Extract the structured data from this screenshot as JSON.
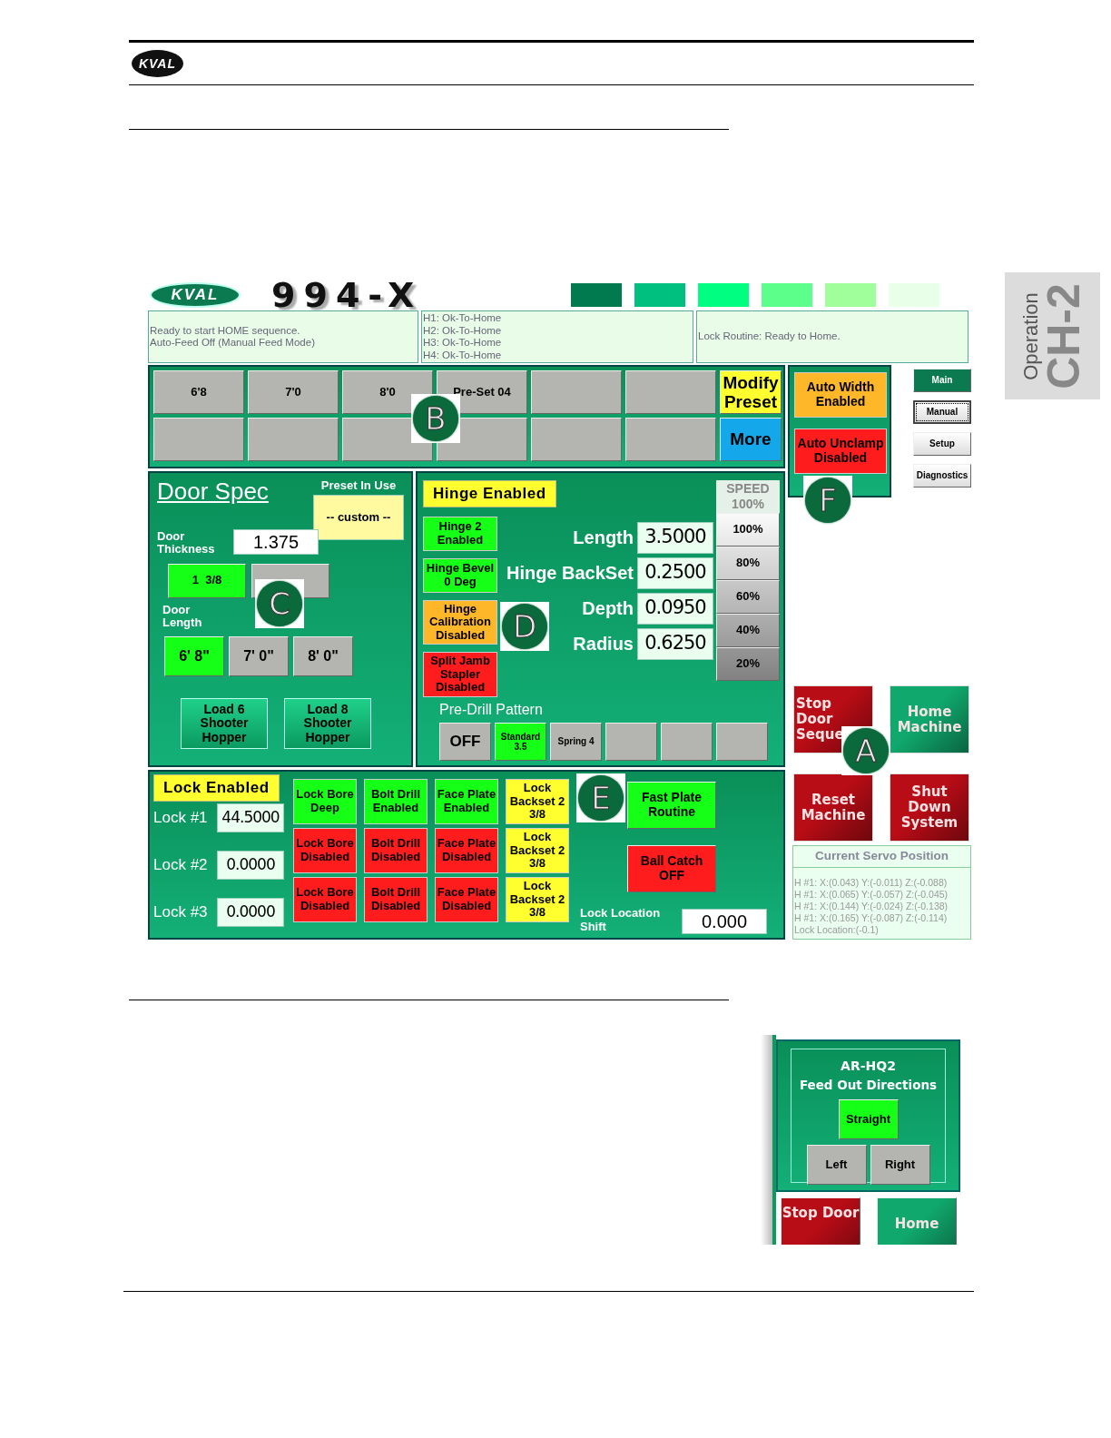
{
  "document": {
    "brand": "KVAL",
    "side_tab": {
      "section": "Operation",
      "chapter": "CH-2"
    }
  },
  "hmi": {
    "brand": "KVAL",
    "model": "994-X",
    "swatches": [
      {
        "color": "#007a4e"
      },
      {
        "color": "#00c080"
      },
      {
        "color": "#00ff80"
      },
      {
        "color": "#5cff8a"
      },
      {
        "color": "#a0ff9a"
      },
      {
        "color": "#e8ffe8"
      }
    ],
    "status_panes": [
      {
        "lines": [
          "Ready to start HOME sequence.",
          "Auto-Feed Off (Manual Feed Mode)"
        ]
      },
      {
        "lines": [
          "H1: Ok-To-Home",
          "H2: Ok-To-Home",
          "H3: Ok-To-Home",
          "H4: Ok-To-Home"
        ]
      },
      {
        "lines": [
          "Lock Routine: Ready to Home."
        ]
      }
    ],
    "presets": {
      "callout": "B",
      "items": [
        {
          "label": "6'8"
        },
        {
          "label": "7'0"
        },
        {
          "label": "8'0"
        },
        {
          "label": "Pre-Set 04"
        }
      ],
      "actions": [
        {
          "label": "Modify Preset",
          "color": "#ffff30"
        },
        {
          "label": "More",
          "color": "#14a8ea"
        }
      ]
    },
    "auto_settings": {
      "callout": "F",
      "items": [
        {
          "label": "Auto Width Enabled",
          "color": "#ffb72a"
        },
        {
          "label": "Auto Unclamp Disabled",
          "color": "#ff1c1c"
        }
      ]
    },
    "nav": [
      {
        "label": "Main",
        "selected": true,
        "focused": false
      },
      {
        "label": "Manual",
        "selected": false,
        "focused": true
      },
      {
        "label": "Setup",
        "selected": false,
        "focused": false
      },
      {
        "label": "Diagnostics",
        "selected": false,
        "focused": false
      }
    ],
    "door_spec": {
      "callout": "C",
      "title": "Door Spec",
      "preset_label": "Preset In Use",
      "preset": "-- custom --",
      "thickness_label": "Door Thickness",
      "thickness": "1.375",
      "thickness_options": [
        {
          "label": "1  3/8",
          "selected": true
        },
        {
          "selected": false
        }
      ],
      "length_label": "Door Length",
      "length_options": [
        {
          "label": "6' 8\"",
          "selected": true
        },
        {
          "label": "7' 0\"",
          "selected": false
        },
        {
          "label": "8' 0\"",
          "selected": false
        }
      ],
      "load_buttons": [
        "Load 6 Shooter Hopper",
        "Load 8 Shooter Hopper"
      ]
    },
    "hinge": {
      "callout": "D",
      "title": "Hinge Enabled",
      "toggles": [
        {
          "label": "Hinge 2 Enabled",
          "color": "#16ff16"
        },
        {
          "label": "Hinge Bevel 0 Deg",
          "color": "#16ff16"
        },
        {
          "label": "Hinge Calibration Disabled",
          "color": "#ffb72a"
        },
        {
          "label": "Split Jamb Stapler Disabled",
          "color": "#ff1c1c"
        }
      ],
      "params": [
        {
          "label": "Length",
          "value": "3.5000"
        },
        {
          "label": "Hinge BackSet",
          "value": "0.2500"
        },
        {
          "label": "Depth",
          "value": "0.0950"
        },
        {
          "label": "Radius",
          "value": "0.6250"
        }
      ],
      "speed": {
        "title": "SPEED",
        "current": "100%",
        "options": [
          "100%",
          "80%",
          "60%",
          "40%",
          "20%"
        ]
      },
      "pre_drill": {
        "label": "Pre-Drill Pattern",
        "options": [
          {
            "label": "OFF",
            "selected": false
          },
          {
            "label": "Standard 3.5",
            "selected": true
          },
          {
            "label": "Spring 4",
            "selected": false
          }
        ]
      }
    },
    "lock": {
      "callout": "E",
      "title": "Lock Enabled",
      "rows": [
        {
          "label": "Lock #1",
          "value": "44.5000",
          "toggles": [
            {
              "label": "Lock Bore Deep",
              "color": "#16ff16"
            },
            {
              "label": "Bolt Drill Enabled",
              "color": "#16ff16"
            },
            {
              "label": "Face Plate Enabled",
              "color": "#16ff16"
            },
            {
              "label": "Lock Backset 2 3/8",
              "color": "#ffff30"
            }
          ]
        },
        {
          "label": "Lock #2",
          "value": "0.0000",
          "toggles": [
            {
              "label": "Lock Bore Disabled",
              "color": "#ff1c1c"
            },
            {
              "label": "Bolt Drill Disabled",
              "color": "#ff1c1c"
            },
            {
              "label": "Face Plate Disabled",
              "color": "#ff1c1c"
            },
            {
              "label": "Lock Backset 2 3/8",
              "color": "#ffff30"
            }
          ]
        },
        {
          "label": "Lock #3",
          "value": "0.0000",
          "toggles": [
            {
              "label": "Lock Bore Disabled",
              "color": "#ff1c1c"
            },
            {
              "label": "Bolt Drill Disabled",
              "color": "#ff1c1c"
            },
            {
              "label": "Face Plate Disabled",
              "color": "#ff1c1c"
            },
            {
              "label": "Lock Backset 2 3/8",
              "color": "#ffff30"
            }
          ]
        }
      ],
      "fast_plate": {
        "label": "Fast Plate Routine",
        "color": "#16ff16"
      },
      "ball_catch": {
        "label": "Ball Catch OFF",
        "color": "#ff1c1c"
      },
      "shift_label": "Lock Location Shift",
      "shift": "0.000"
    },
    "machine": {
      "callout": "A",
      "buttons": [
        {
          "label": "Stop Door Seque",
          "color": "#b80c16"
        },
        {
          "label": "Home Machine",
          "color": "#10a86c"
        },
        {
          "label": "Reset Machine",
          "color": "#b80c16"
        },
        {
          "label": "Shut Down System",
          "color": "#b80c16"
        }
      ]
    },
    "servo": {
      "title": "Current Servo Position",
      "lines": [
        "H #1: X:(0.043) Y:(-0.011) Z:(-0.088)",
        "H #1: X:(0.065) Y:(-0.057) Z:(-0.045)",
        "H #1: X:(0.144) Y:(-0.024) Z:(-0.138)",
        "H #1: X:(0.165) Y:(-0.087) Z:(-0.114)",
        "Lock Location:(-0.1)"
      ]
    }
  },
  "excerpt": {
    "title": "AR-HQ2",
    "subtitle": "Feed Out Directions",
    "options": [
      {
        "label": "Straight",
        "selected": true
      },
      {
        "label": "Left",
        "selected": false
      },
      {
        "label": "Right",
        "selected": false
      }
    ],
    "buttons": [
      {
        "label": "Stop Door",
        "color": "#b80c16"
      },
      {
        "label": "Home",
        "color": "#10a86c"
      }
    ]
  }
}
